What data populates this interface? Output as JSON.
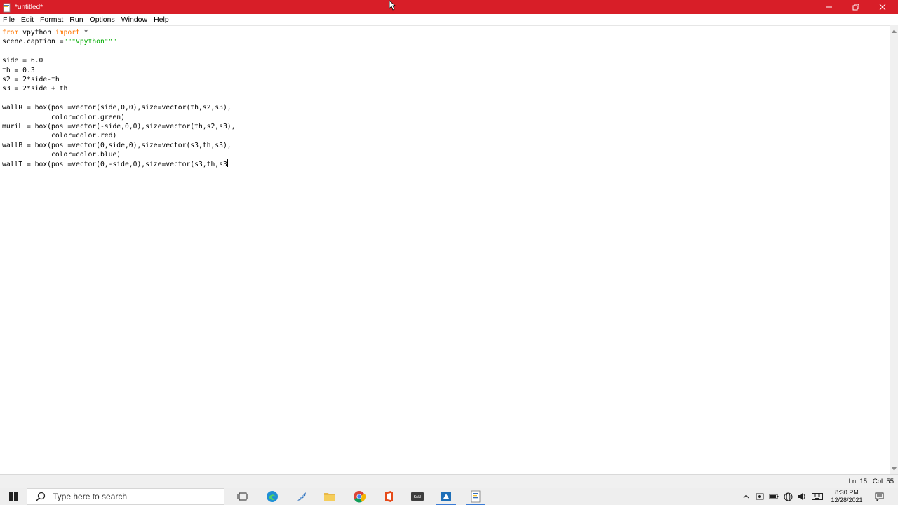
{
  "window": {
    "title": "*untitled*"
  },
  "menu": {
    "items": [
      "File",
      "Edit",
      "Format",
      "Run",
      "Options",
      "Window",
      "Help"
    ]
  },
  "editor": {
    "lines": [
      [
        {
          "t": "from",
          "c": "kw"
        },
        {
          "t": " vpython "
        },
        {
          "t": "import",
          "c": "kw"
        },
        {
          "t": " *"
        }
      ],
      [
        {
          "t": "scene.caption ="
        },
        {
          "t": "\"\"\"Vpython\"\"\"",
          "c": "str"
        }
      ],
      [],
      [
        {
          "t": "side = 6.0"
        }
      ],
      [
        {
          "t": "th = 0.3"
        }
      ],
      [
        {
          "t": "s2 = 2*side-th"
        }
      ],
      [
        {
          "t": "s3 = 2*side + th"
        }
      ],
      [],
      [
        {
          "t": "wallR = box(pos =vector(side,0,0),size=vector(th,s2,s3),"
        }
      ],
      [
        {
          "t": "            color=color.green)"
        }
      ],
      [
        {
          "t": "muriL = box(pos =vector(-side,0,0),size=vector(th,s2,s3),"
        }
      ],
      [
        {
          "t": "            color=color.red)"
        }
      ],
      [
        {
          "t": "wallB = box(pos =vector(0,side,0),size=vector(s3,th,s3),"
        }
      ],
      [
        {
          "t": "            color=color.blue)"
        }
      ],
      [
        {
          "t": "wallT = box(pos =vector(0,-side,0),size=vector(s3,th,s3"
        }
      ]
    ],
    "keyword_color": "#ff7700",
    "string_color": "#00aa00"
  },
  "status": {
    "line": "Ln: 15",
    "col": "Col: 55"
  },
  "taskbar": {
    "search_placeholder": "Type here to search",
    "time": "8:30 PM",
    "date": "12/28/2021",
    "apps": [
      "task-view-icon",
      "edge-icon",
      "python-feather-icon",
      "file-explorer-icon",
      "chrome-icon",
      "office-icon",
      "kali-icon",
      "vscode-like-icon",
      "idle-icon"
    ]
  },
  "colors": {
    "titlebar": "#d81e28",
    "taskbar": "#eeeeee"
  }
}
